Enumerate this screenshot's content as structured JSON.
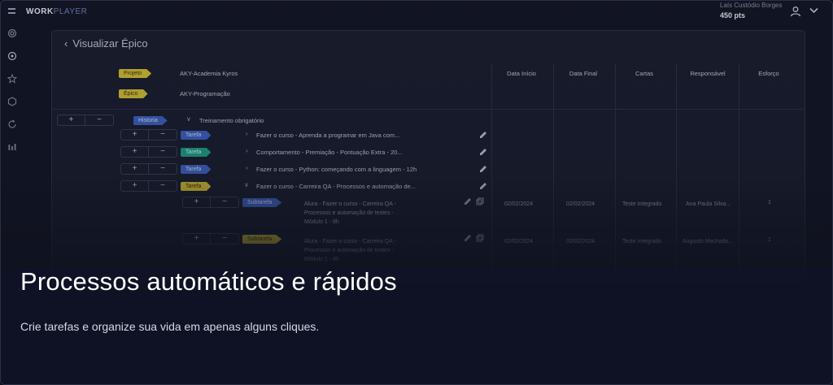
{
  "header": {
    "logo_part1": "WORK",
    "logo_part2": "PLAYER",
    "user_name": "Laís Custódio Borges",
    "user_points": "450 pts"
  },
  "panel": {
    "title": "Visualizar Épico",
    "meta": [
      {
        "tag": "Projeto",
        "value": "AKY-Academia Kyros"
      },
      {
        "tag": "Épico",
        "value": "AKY-Programação"
      }
    ],
    "columns": [
      "Data Início",
      "Data Final",
      "Cartas",
      "Responsável",
      "Esforço"
    ],
    "history": {
      "tag": "Historia",
      "label": "Treinamento obrigatório"
    },
    "tasks": [
      {
        "tag": "Tarefa",
        "color": "#3f63c4",
        "label": "Fazer o curso - Aprenda a programar em Java com..."
      },
      {
        "tag": "Tarefa",
        "color": "#1fa38a",
        "label": "Comportamento - Premiação - Pontuação Extra - 20..."
      },
      {
        "tag": "Tarefa",
        "color": "#3f63c4",
        "label": "Fazer o curso - Python: começando com a linguagem - 12h"
      },
      {
        "tag": "Tarefa",
        "color": "#d8c234",
        "label": "Fazer o curso - Carreira QA - Processos e automação de..."
      }
    ],
    "subtasks": [
      {
        "tag": "Subtarefa",
        "color": "#3f63c4",
        "label": "Alura - Fazer o curso - Carreira QA - Processos e automação de testes - Módulo 1 - 8h",
        "start": "02/02/2024",
        "end": "02/02/2024",
        "cards": "Teste Integrado",
        "owner": "Ana Paula Silva...",
        "effort": "1"
      },
      {
        "tag": "Subtarefa",
        "color": "#d8c234",
        "label": "Alura - Fazer o curso - Carreira QA - Processos e automação de testes - Módulo 1 - 8h",
        "start": "02/02/2024",
        "end": "02/02/2024",
        "cards": "Teste Integrado",
        "owner": "Augusto Machado...",
        "effort": "1"
      }
    ]
  },
  "hero": {
    "headline": "Processos automáticos e rápidos",
    "subline": "Crie tarefas e organize sua vida em apenas alguns cliques."
  },
  "colors": {
    "background": "#121524",
    "panel": "#191d2d",
    "accent_blue": "#3f63c4",
    "accent_yellow": "#d8c234",
    "accent_teal": "#1fa38a"
  }
}
